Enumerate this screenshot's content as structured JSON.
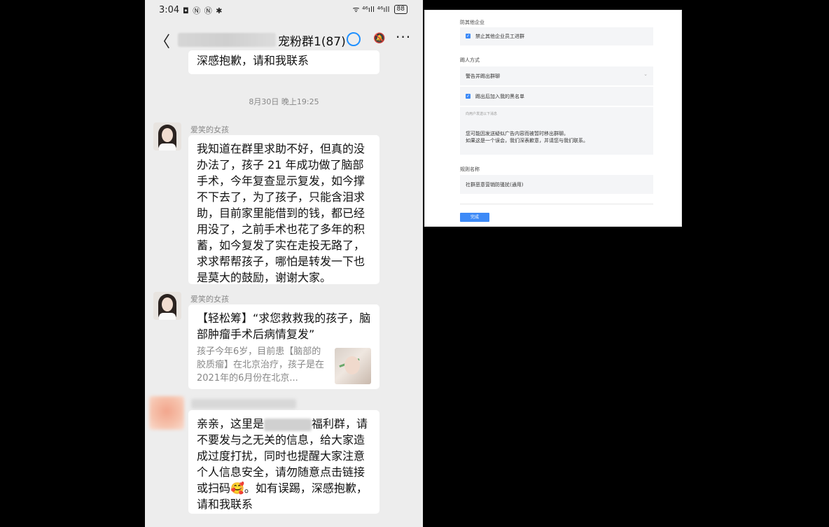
{
  "phone": {
    "status": {
      "time": "3:04",
      "indicators": "◘ Ⓝ Ⓝ ✱",
      "signal": "ᯤ ⁴⁶ıll ⁴⁶ıll",
      "battery": "88"
    },
    "header": {
      "back": "〈",
      "title": "宠粉群1(87)",
      "more": "···"
    },
    "top_bubble": "深感抱歉，请和我联系",
    "timestamp": "8月30日 晚上19:25",
    "messages": [
      {
        "sender": "爱笑的女孩",
        "text": "我知道在群里求助不好，但真的没办法了，孩子 21 年成功做了脑部手术，今年复查显示复发，如今撑不下去了，为了孩子，只能含泪求助，目前家里能借到的钱，都已经用没了，之前手术也花了多年的积蓄，如今复发了实在走投无路了，求求帮帮孩子，哪怕是转发一下也是莫大的鼓励，谢谢大家。"
      },
      {
        "sender": "爱笑的女孩",
        "card": {
          "title": "【轻松筹】“求您救救我的孩子，脑部肿瘤手术后病情复发”",
          "desc": "孩子今年6岁，目前患【脑部的胶质瘤】在北京治疗，孩子是在2021年的6月份在北京..."
        }
      },
      {
        "text_before": "亲亲，这里是",
        "text_after": "福利群，请不要发与之无关的信息，给大家造成过度打扰，同时也提醒大家注意个人信息安全，请勿随意点击链接或扫码🥰。如有误踢，深感抱歉，请和我联系"
      }
    ]
  },
  "settings": {
    "section1_label": "防其他企业",
    "block_employees": "禁止其他企业员工进群",
    "section2_label": "踢人方式",
    "kick_method": "警告并踢出群聊",
    "blacklist": "踢出后加入我的黑名单",
    "warning_hint": "向用户发送以下消息",
    "warning_text_line1": "您可能因发送疑似广告内容而被暂时移出群聊。",
    "warning_text_line2": "如果这是一个误会，我们深表歉意，并请您与我们联系。",
    "section3_label": "规则名称",
    "rule_name": "社群恶意营销防骚扰(通用)",
    "done": "完成"
  }
}
